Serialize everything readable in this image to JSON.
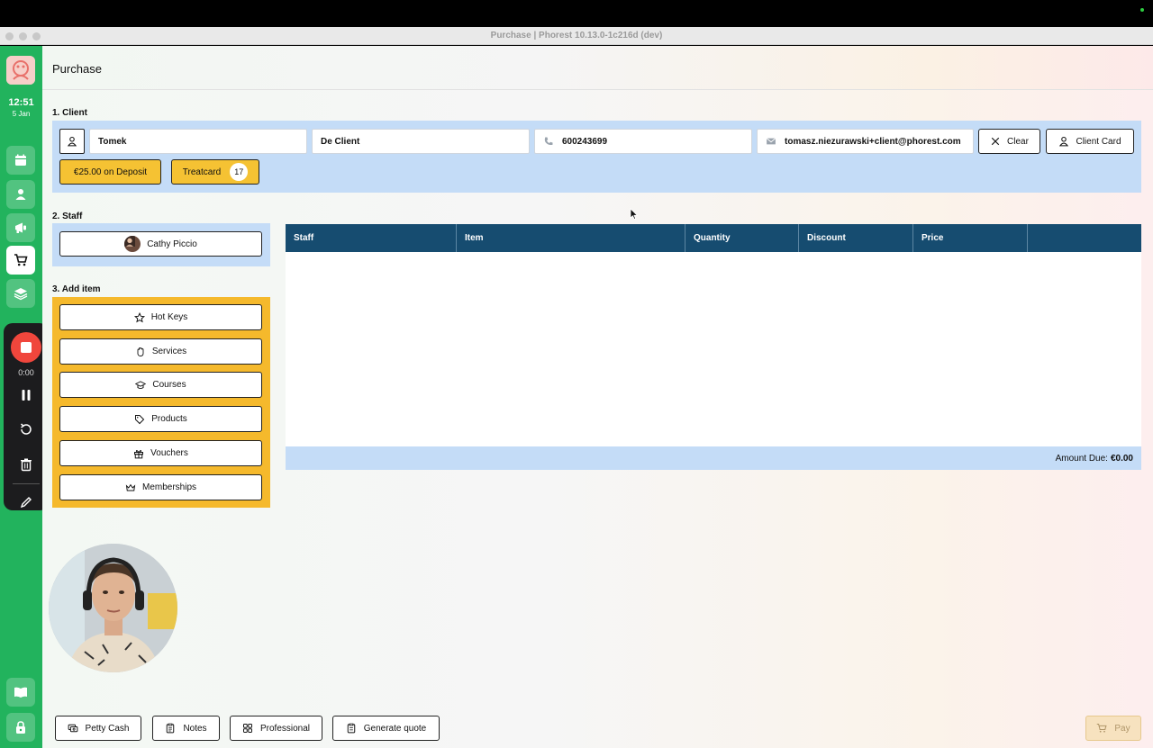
{
  "window": {
    "title": "Purchase | Phorest 10.13.0-1c216d (dev)"
  },
  "sidebar": {
    "clock": {
      "time": "12:51",
      "date": "5 Jan"
    },
    "nav": [
      {
        "icon": "calendar-icon"
      },
      {
        "icon": "client-icon"
      },
      {
        "icon": "megaphone-icon"
      },
      {
        "icon": "cart-icon",
        "active": true
      },
      {
        "icon": "layers-icon"
      },
      {
        "icon": "book-icon"
      },
      {
        "icon": "lock-icon"
      }
    ]
  },
  "recorder": {
    "elapsed": "0:00"
  },
  "page": {
    "title": "Purchase"
  },
  "client": {
    "section_label": "1. Client",
    "first_name": "Tomek",
    "last_name": "De Client",
    "phone": "600243699",
    "email": "tomasz.niezurawski+client@phorest.com",
    "clear_label": "Clear",
    "client_card_label": "Client Card",
    "deposit_label": "€25.00 on Deposit",
    "treatcard_label": "Treatcard",
    "treatcard_count": "17"
  },
  "staff": {
    "section_label": "2. Staff",
    "selected": "Cathy Piccio"
  },
  "add_item": {
    "section_label": "3. Add item",
    "buttons": [
      {
        "label": "Hot Keys",
        "icon": "star-icon"
      },
      {
        "label": "Services",
        "icon": "hand-icon"
      },
      {
        "label": "Courses",
        "icon": "graduation-cap-icon"
      },
      {
        "label": "Products",
        "icon": "tag-icon"
      },
      {
        "label": "Vouchers",
        "icon": "gift-icon"
      },
      {
        "label": "Memberships",
        "icon": "crown-icon"
      }
    ]
  },
  "table": {
    "columns": [
      "Staff",
      "Item",
      "Quantity",
      "Discount",
      "Price",
      ""
    ],
    "rows": [],
    "amount_due_label": "Amount Due:",
    "amount_due_value": "€0.00"
  },
  "footer": {
    "petty_cash": "Petty Cash",
    "notes": "Notes",
    "professional": "Professional",
    "generate_quote": "Generate quote",
    "pay": "Pay"
  },
  "colors": {
    "sidebar": "#22b35d",
    "panel_blue": "#c4dcf7",
    "panel_yellow": "#f5b92c",
    "table_header": "#164c70",
    "recorder_stop": "#f0463c"
  }
}
